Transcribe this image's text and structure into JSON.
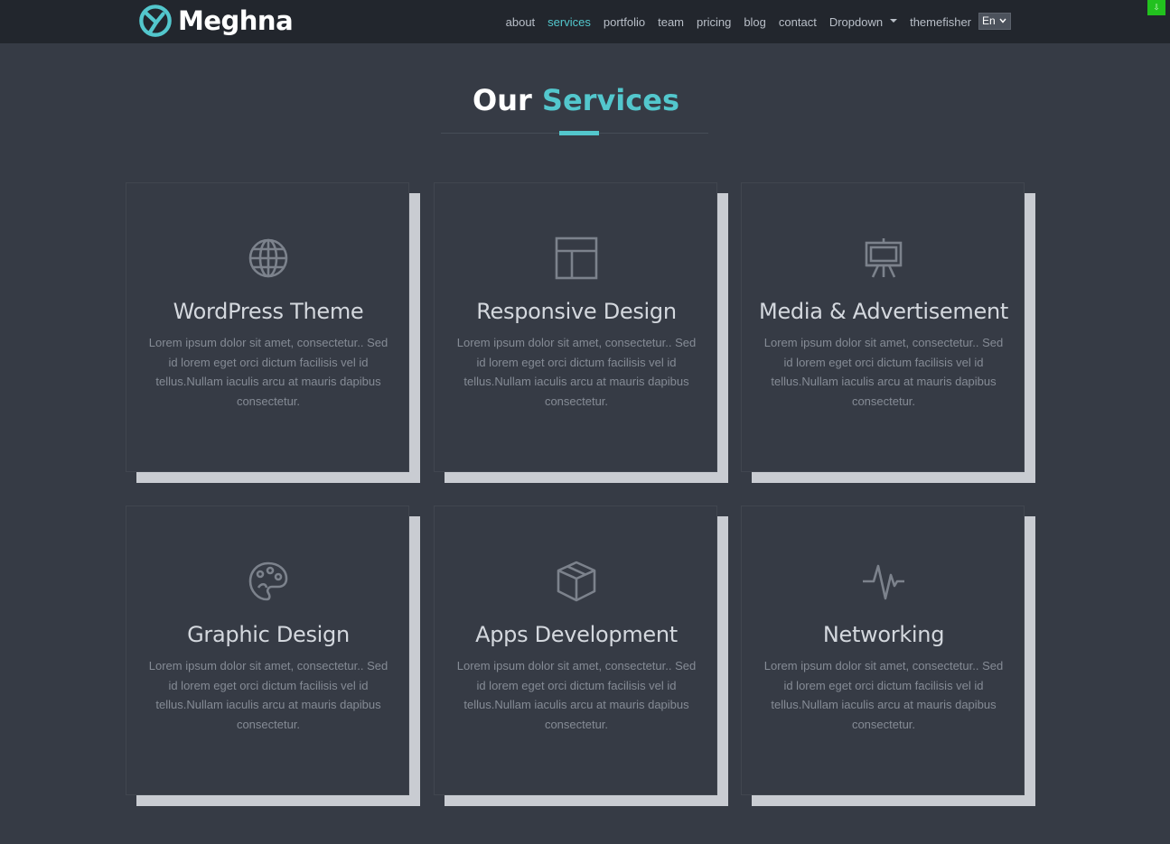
{
  "nav": {
    "brand": "Meghna",
    "items": [
      {
        "label": "about",
        "name": "nav-about",
        "active": false
      },
      {
        "label": "services",
        "name": "nav-services",
        "active": true
      },
      {
        "label": "portfolio",
        "name": "nav-portfolio",
        "active": false
      },
      {
        "label": "team",
        "name": "nav-team",
        "active": false
      },
      {
        "label": "pricing",
        "name": "nav-pricing",
        "active": false
      },
      {
        "label": "blog",
        "name": "nav-blog",
        "active": false
      },
      {
        "label": "contact",
        "name": "nav-contact",
        "active": false
      },
      {
        "label": "Dropdown",
        "name": "nav-dropdown",
        "active": false,
        "caret": true
      },
      {
        "label": "themefisher",
        "name": "nav-themefisher",
        "active": false
      }
    ],
    "language": "En"
  },
  "indicator": "⇩",
  "section": {
    "title_main": "Our",
    "title_accent": "Services"
  },
  "services": [
    {
      "title": "WordPress Theme",
      "icon": "globe-icon",
      "text": "Lorem ipsum dolor sit amet, consectetur.. Sed id lorem eget orci dictum facilisis vel id tellus.Nullam iaculis arcu at mauris dapibus consectetur."
    },
    {
      "title": "Responsive Design",
      "icon": "layout-icon",
      "text": "Lorem ipsum dolor sit amet, consectetur.. Sed id lorem eget orci dictum facilisis vel id tellus.Nullam iaculis arcu at mauris dapibus consectetur."
    },
    {
      "title": "Media & Advertisement",
      "icon": "easel-icon",
      "text": "Lorem ipsum dolor sit amet, consectetur.. Sed id lorem eget orci dictum facilisis vel id tellus.Nullam iaculis arcu at mauris dapibus consectetur."
    },
    {
      "title": "Graphic Design",
      "icon": "palette-icon",
      "text": "Lorem ipsum dolor sit amet, consectetur.. Sed id lorem eget orci dictum facilisis vel id tellus.Nullam iaculis arcu at mauris dapibus consectetur."
    },
    {
      "title": "Apps Development",
      "icon": "box-icon",
      "text": "Lorem ipsum dolor sit amet, consectetur.. Sed id lorem eget orci dictum facilisis vel id tellus.Nullam iaculis arcu at mauris dapibus consectetur."
    },
    {
      "title": "Networking",
      "icon": "pulse-icon",
      "text": "Lorem ipsum dolor sit amet, consectetur.. Sed id lorem eget orci dictum facilisis vel id tellus.Nullam iaculis arcu at mauris dapibus consectetur."
    }
  ],
  "colors": {
    "background": "#363b45",
    "navbar": "#22262d",
    "accent": "#53c7cd",
    "card_shadow": "#c9ccd2"
  }
}
